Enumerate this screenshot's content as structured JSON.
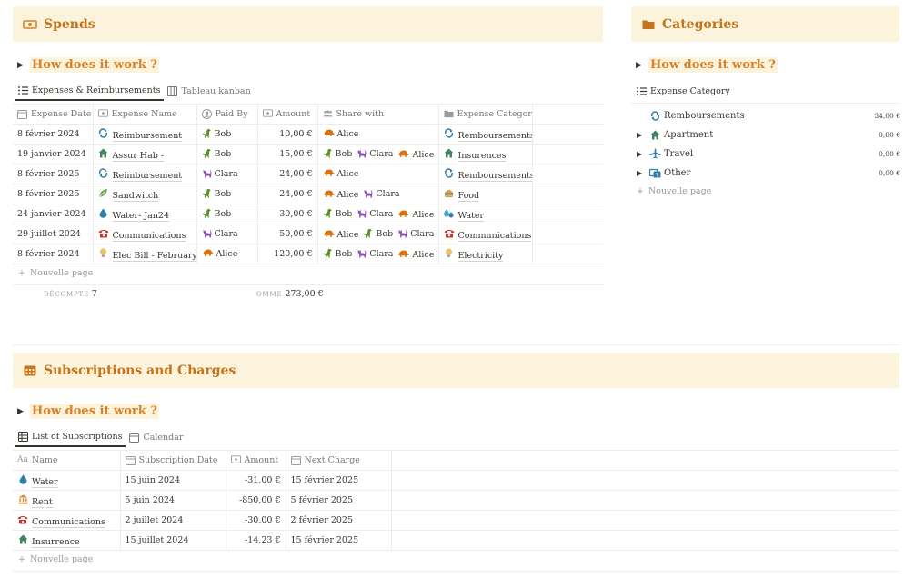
{
  "spends": {
    "title": "Spends",
    "toggle": "How does it work ?",
    "tabs": [
      "Expenses & Reimbursements",
      "Tableau kanban"
    ],
    "columns": [
      "Expense Date",
      "Expense Name",
      "Paid By",
      "Amount",
      "Share with",
      "Expense Category"
    ],
    "rows": [
      {
        "date": "8 février 2024",
        "name": "Reimbursement",
        "name_icon": "refresh",
        "paid_by": "Bob",
        "amount": "10,00 €",
        "share": [
          "Alice"
        ],
        "category": "Remboursements",
        "cat_icon": "refresh"
      },
      {
        "date": "19 janvier 2024",
        "name": "Assur Hab -",
        "name_icon": "house",
        "paid_by": "Bob",
        "amount": "15,00 €",
        "share": [
          "Bob",
          "Clara",
          "Alice"
        ],
        "category": "Insurences",
        "cat_icon": "house"
      },
      {
        "date": "8 février 2025",
        "name": "Reimbursement",
        "name_icon": "refresh",
        "paid_by": "Clara",
        "amount": "24,00 €",
        "share": [
          "Alice"
        ],
        "category": "Remboursements",
        "cat_icon": "refresh"
      },
      {
        "date": "8 février 2025",
        "name": "Sandwitch",
        "name_icon": "leaf",
        "paid_by": "Bob",
        "amount": "24,00 €",
        "share": [
          "Alice",
          "Clara"
        ],
        "category": "Food",
        "cat_icon": "burger"
      },
      {
        "date": "24 janvier 2024",
        "name": "Water- Jan24",
        "name_icon": "drop",
        "paid_by": "Bob",
        "amount": "30,00 €",
        "share": [
          "Bob",
          "Clara",
          "Alice"
        ],
        "category": "Water",
        "cat_icon": "drops"
      },
      {
        "date": "29 juillet 2024",
        "name": "Communications",
        "name_icon": "phone",
        "paid_by": "Clara",
        "amount": "50,00 €",
        "share": [
          "Alice",
          "Bob",
          "Clara"
        ],
        "category": "Communications",
        "cat_icon": "phone"
      },
      {
        "date": "8 février 2024",
        "name": "Elec Bill - February24",
        "name_icon": "bulb",
        "paid_by": "Alice",
        "amount": "120,00 €",
        "share": [
          "Bob",
          "Clara",
          "Alice"
        ],
        "category": "Electricity",
        "cat_icon": "bulb"
      }
    ],
    "new_page": "Nouvelle page",
    "count_label": "DÉCOMPTE",
    "count_value": "7",
    "sum_label": "OMME",
    "sum_value": "273,00 €"
  },
  "people_icons": {
    "Bob": "dino",
    "Clara": "cat",
    "Alice": "turtle"
  },
  "people_colors": {
    "Bob": "#5a8f29",
    "Clara": "#8b4fb3",
    "Alice": "#d9730d"
  },
  "categories": {
    "title": "Categories",
    "toggle": "How does it work ?",
    "tab": "Expense Category",
    "items": [
      {
        "name": "Remboursements",
        "icon": "refresh",
        "amount": "34,00 €",
        "expandable": false
      },
      {
        "name": "Apartment",
        "icon": "house",
        "amount": "0,00 €",
        "expandable": true
      },
      {
        "name": "Travel",
        "icon": "plane",
        "amount": "0,00 €",
        "expandable": true
      },
      {
        "name": "Other",
        "icon": "other",
        "amount": "0,00 €",
        "expandable": true
      }
    ],
    "new_page": "Nouvelle page"
  },
  "subscriptions": {
    "title": "Subscriptions and Charges",
    "toggle": "How does it work ?",
    "tabs": [
      "List of Subscriptions",
      "Calendar"
    ],
    "columns": [
      "Name",
      "Subscription Date",
      "Amount",
      "Next Charge"
    ],
    "rows": [
      {
        "name": "Water",
        "icon": "drop",
        "date": "15 juin 2024",
        "amount": "-31,00 €",
        "next": "15 février 2025"
      },
      {
        "name": "Rent",
        "icon": "bank",
        "date": "5 juin 2024",
        "amount": "-850,00 €",
        "next": "5 février 2025"
      },
      {
        "name": "Communications",
        "icon": "phone",
        "date": "2 juillet 2024",
        "amount": "-30,00 €",
        "next": "2 février 2025"
      },
      {
        "name": "Insurrence",
        "icon": "house",
        "date": "15 juillet 2024",
        "amount": "-14,23 €",
        "next": "15 février 2025"
      }
    ],
    "new_page": "Nouvelle page",
    "name_prefix": "Aa"
  },
  "colors": {
    "accent": "#d9822b",
    "banner": "#fbf3db",
    "blue": "#337ea9",
    "green": "#448361"
  }
}
